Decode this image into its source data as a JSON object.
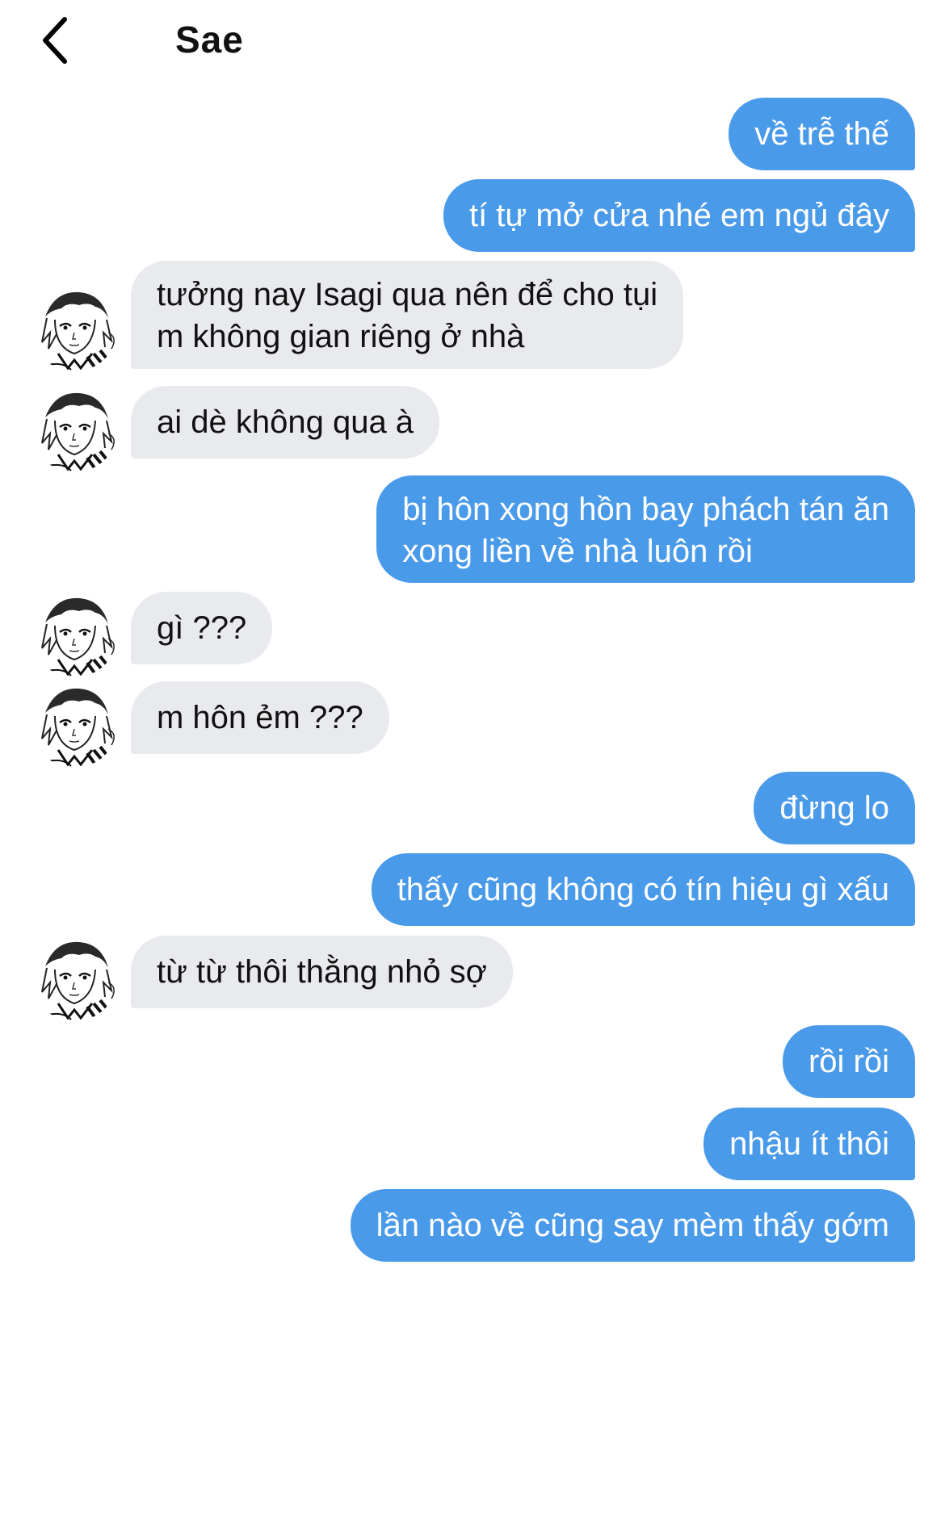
{
  "header": {
    "title": "Sae"
  },
  "colors": {
    "outgoing_bubble": "#4a9aea",
    "incoming_bubble": "#e9eaee",
    "background": "#ffffff"
  },
  "messages": [
    {
      "from": "me",
      "text": "về trễ thế"
    },
    {
      "from": "me",
      "text": "tí tự mở cửa nhé em ngủ đây"
    },
    {
      "from": "Sae",
      "line1": "tưởng nay Isagi qua nên để cho tụi",
      "line2": "m không gian riêng ở nhà"
    },
    {
      "from": "Sae",
      "text": "ai dè không qua à"
    },
    {
      "from": "me",
      "line1": "bị hôn xong hồn bay phách tán ăn",
      "line2": "xong liền về nhà luôn rồi"
    },
    {
      "from": "Sae",
      "text": "gì ???"
    },
    {
      "from": "Sae",
      "text": "m hôn ẻm ???"
    },
    {
      "from": "me",
      "text": "đừng lo"
    },
    {
      "from": "me",
      "text": "thấy cũng không có tín hiệu gì xấu"
    },
    {
      "from": "Sae",
      "text": "từ từ thôi thằng nhỏ sợ"
    },
    {
      "from": "me",
      "text": "rồi rồi"
    },
    {
      "from": "me",
      "text": "nhậu ít thôi"
    },
    {
      "from": "me",
      "text": "lần nào về cũng say mèm thấy gớm"
    }
  ]
}
